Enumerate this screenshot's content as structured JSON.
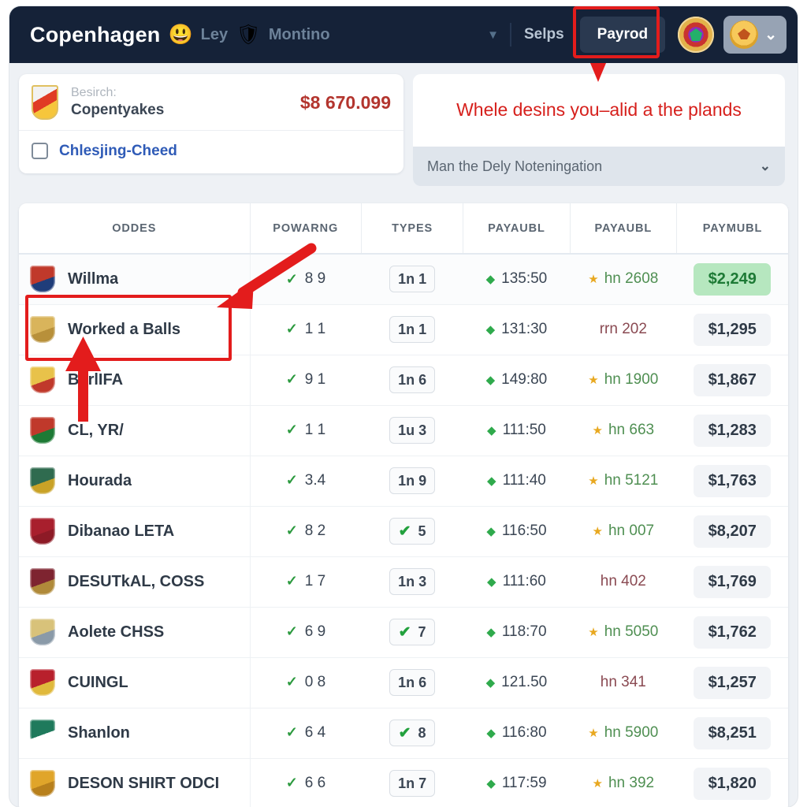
{
  "topbar": {
    "title": "Copenhagen",
    "emoji": "😃",
    "dim_label_1": "Ley",
    "shield_emoji": "🛡",
    "dim_label_2": "Montino",
    "chevron": "▼",
    "selps_label": "Selps",
    "payrod_label": "Payrod",
    "crest_icon": "crest-icon",
    "account_chevron": "⌄"
  },
  "left_card": {
    "label": "Besirch:",
    "name": "Copentyakes",
    "amount": "$8 670.099",
    "link": "Chlesjing-Cheed"
  },
  "right_card": {
    "note": "Whele desins you–alid a the plands",
    "select_value": "Man the Dely Noteningation",
    "select_chevron": "⌄"
  },
  "table": {
    "columns": [
      "ODDES",
      "POWARNG",
      "TYPES",
      "PAYAUBL",
      "PAYAUBL",
      "PAYMUBL"
    ],
    "rows": [
      {
        "name": "Willma",
        "icon": "down-arrow-icon",
        "pow": "8 9",
        "type": "1n 1",
        "type_check": false,
        "pa1": "135:50",
        "pa2": "hn 2608",
        "pa2_star": true,
        "pm": "$2,249",
        "pm_good": true,
        "tinted": true
      },
      {
        "name": "Worked a Balls",
        "icon": "wings-badge-icon",
        "pow": "1 1",
        "type": "1n 1",
        "type_check": false,
        "pa1": "131:30",
        "pa2": "rrn 202",
        "pa2_star": false,
        "pm": "$1,295",
        "pm_good": false,
        "tinted": false
      },
      {
        "name": "BarlIFA",
        "icon": "gold-shield-icon",
        "pow": "9 1",
        "type": "1n 6",
        "type_check": false,
        "pa1": "149:80",
        "pa2": "hn 1900",
        "pa2_star": true,
        "pm": "$1,867",
        "pm_good": false,
        "tinted": false
      },
      {
        "name": "CL, YR/",
        "icon": "tricolor-shield-icon",
        "pow": "1 1",
        "type": "1u 3",
        "type_check": false,
        "pa1": "111:50",
        "pa2": "hn 663",
        "pa2_star": true,
        "pm": "$1,283",
        "pm_good": false,
        "tinted": false
      },
      {
        "name": "Hourada",
        "icon": "trophy-icon",
        "pow": "3.4",
        "type": "1n 9",
        "type_check": false,
        "pa1": "111:40",
        "pa2": "hn 5121",
        "pa2_star": true,
        "pm": "$1,763",
        "pm_good": false,
        "tinted": false
      },
      {
        "name": "Dibanao LETA",
        "icon": "red-wings-icon",
        "pow": "8 2",
        "type": "5",
        "type_check": true,
        "pa1": "116:50",
        "pa2": "hn 007",
        "pa2_star": true,
        "pm": "$8,207",
        "pm_good": false,
        "tinted": false
      },
      {
        "name": "DESUTkAL, COSS",
        "icon": "maroon-crest-icon",
        "pow": "1 7",
        "type": "1n 3",
        "type_check": false,
        "pa1": "111:60",
        "pa2": "hn 402",
        "pa2_star": false,
        "pm": "$1,769",
        "pm_good": false,
        "tinted": false
      },
      {
        "name": "Aolete CHSS",
        "icon": "gold-ring-icon",
        "pow": "6 9",
        "type": "7",
        "type_check": true,
        "pa1": "118:70",
        "pa2": "hn 5050",
        "pa2_star": true,
        "pm": "$1,762",
        "pm_good": false,
        "tinted": false
      },
      {
        "name": "CUINGL",
        "icon": "red-shield-icon",
        "pow": "0 8",
        "type": "1n 6",
        "type_check": false,
        "pa1": "121.50",
        "pa2": "hn 341",
        "pa2_star": false,
        "pm": "$1,257",
        "pm_good": false,
        "tinted": false
      },
      {
        "name": "Shanlon",
        "icon": "green-seal-icon",
        "pow": "6 4",
        "type": "8",
        "type_check": true,
        "pa1": "116:80",
        "pa2": "hn 5900",
        "pa2_star": true,
        "pm": "$8,251",
        "pm_good": false,
        "tinted": false
      },
      {
        "name": "DESON SHIRT ODCI",
        "icon": "gold-emblem-icon",
        "pow": "6 6",
        "type": "1n 7",
        "type_check": false,
        "pa1": "117:59",
        "pa2": "hn 392",
        "pa2_star": true,
        "pm": "$1,820",
        "pm_good": false,
        "tinted": false
      }
    ]
  },
  "annotations": {
    "accent_color": "#e31c1c"
  }
}
